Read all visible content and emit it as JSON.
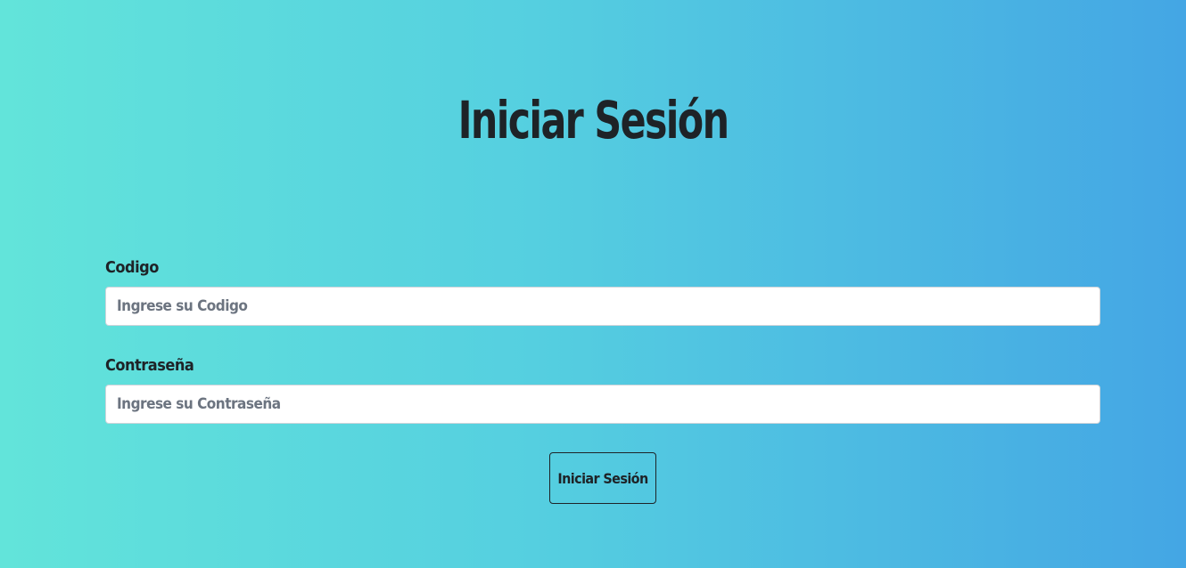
{
  "page": {
    "title": "Iniciar Sesión"
  },
  "form": {
    "code": {
      "label": "Codigo",
      "value": "",
      "placeholder": "Ingrese su Codigo"
    },
    "password": {
      "label": "Contraseña",
      "value": "",
      "placeholder": "Ingrese su Contraseña"
    },
    "submit_label": "Iniciar Sesión"
  },
  "colors": {
    "background_start": "#62e4da",
    "background_end": "#44a6e4",
    "text": "#1e2327",
    "placeholder": "#6c7480"
  }
}
